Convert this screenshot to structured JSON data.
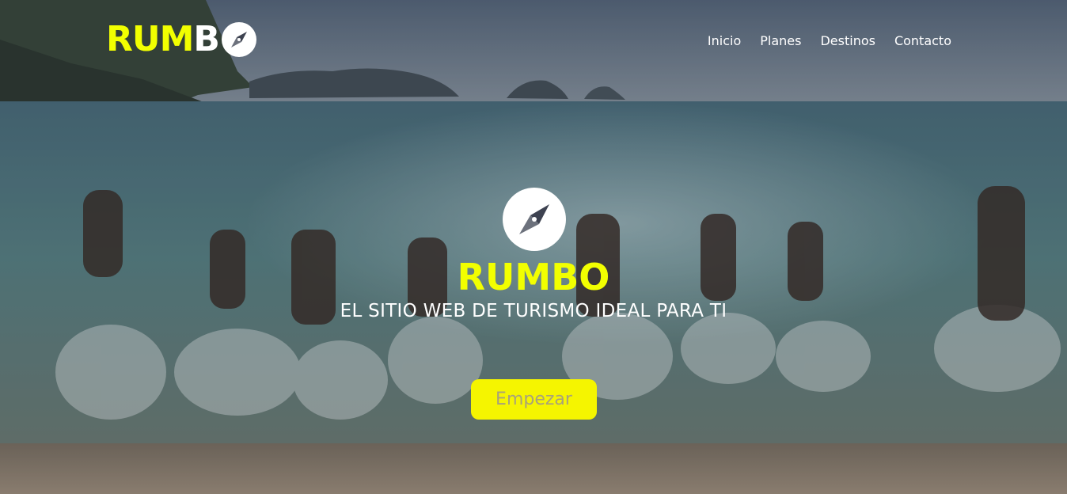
{
  "brand": {
    "logo_part1": "RUM",
    "logo_part2": "B",
    "logo_icon": "compass-icon",
    "accent_yellow": "#f2ff00",
    "white": "#ffffff"
  },
  "nav": {
    "items": [
      {
        "label": "Inicio"
      },
      {
        "label": "Planes"
      },
      {
        "label": "Destinos"
      },
      {
        "label": "Contacto"
      }
    ]
  },
  "hero": {
    "icon": "compass-icon",
    "title": "RUMBO",
    "subtitle": "EL SITIO WEB DE TURISMO IDEAL PARA TI",
    "cta_label": "Empezar",
    "cta_color": "#f5f500",
    "background_image": "people-running-into-sea-photo"
  }
}
